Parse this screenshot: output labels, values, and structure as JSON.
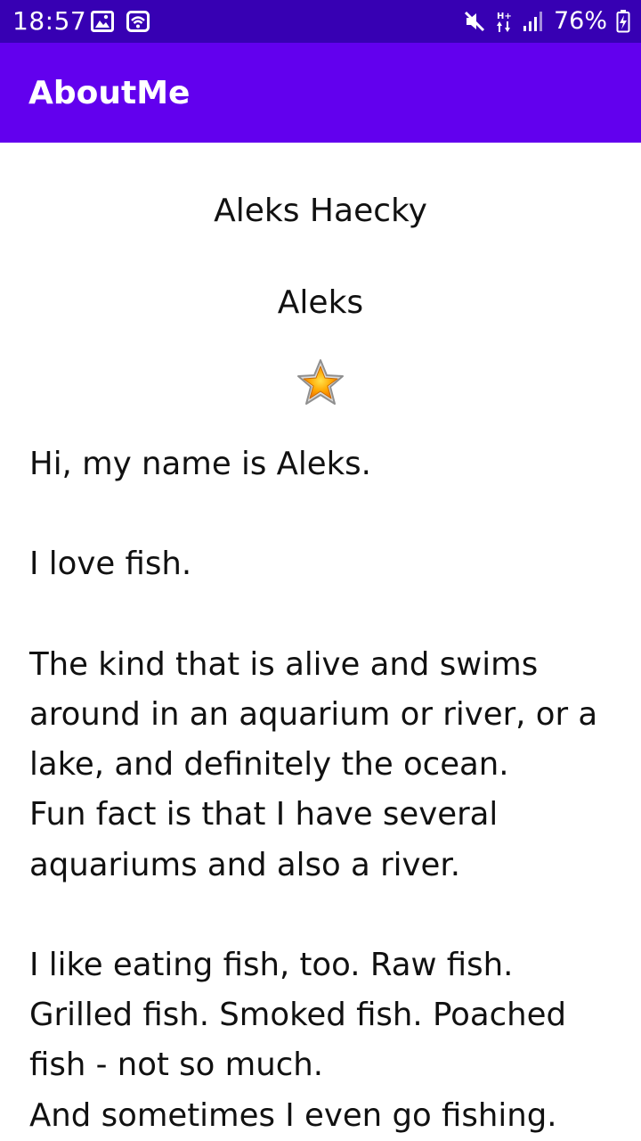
{
  "status_bar": {
    "time": "18:57",
    "battery": "76%",
    "icons": [
      "image-icon",
      "wifi-calling-icon",
      "mute-icon",
      "data-hplus-icon",
      "signal-icon",
      "battery-charging-icon"
    ]
  },
  "app_bar": {
    "title": "AboutMe"
  },
  "profile": {
    "name": "Aleks Haecky",
    "nickname": "Aleks",
    "star_icon": "star-icon",
    "bio": "Hi, my name is Aleks.\n\nI love fish.\n\nThe kind that is alive and swims\naround in an aquarium or river, or a\nlake, and definitely the ocean.\nFun fact is that I have several\naquariums and also a river.\n\nI like eating fish, too. Raw fish.\nGrilled fish. Smoked fish. Poached\nfish - not so much.\nAnd sometimes I even go fishing."
  },
  "colors": {
    "status_bar": "#3700b3",
    "app_bar": "#6200ee",
    "text": "#111111",
    "background": "#ffffff"
  }
}
